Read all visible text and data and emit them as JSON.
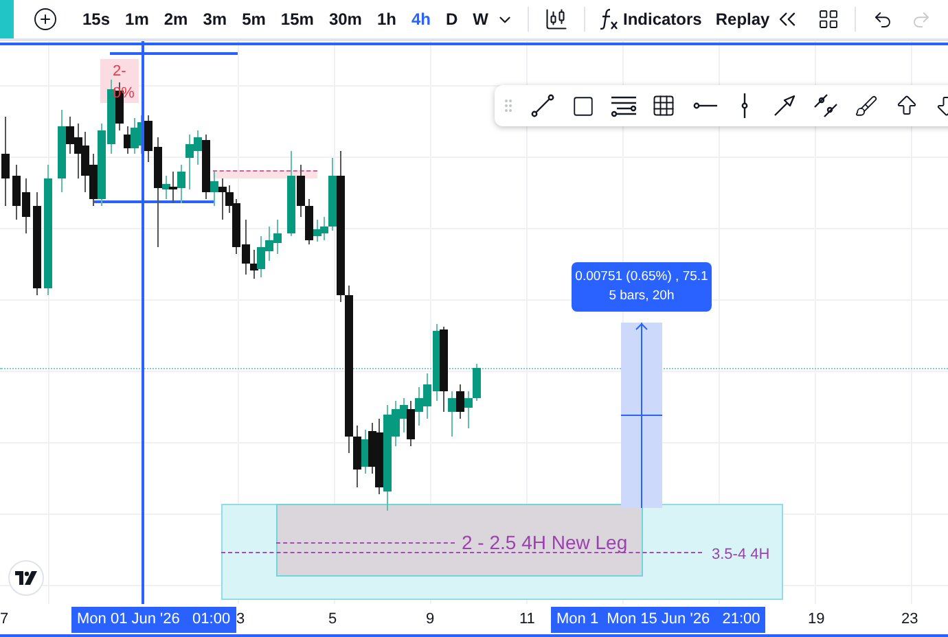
{
  "toolbar": {
    "intervals": [
      {
        "label": "15s",
        "selected": false
      },
      {
        "label": "1m",
        "selected": false
      },
      {
        "label": "2m",
        "selected": false
      },
      {
        "label": "3m",
        "selected": false
      },
      {
        "label": "5m",
        "selected": false
      },
      {
        "label": "15m",
        "selected": false
      },
      {
        "label": "30m",
        "selected": false
      },
      {
        "label": "1h",
        "selected": false
      },
      {
        "label": "4h",
        "selected": true
      },
      {
        "label": "D",
        "selected": false
      },
      {
        "label": "W",
        "selected": false
      }
    ],
    "indicators": "Indicators",
    "replay": "Replay",
    "undo": {
      "disabled": false
    },
    "redo": {
      "disabled": true
    }
  },
  "chart": {
    "marker_labels": [
      "2-",
      "0%"
    ],
    "measure": {
      "line_1": "0.00751 (0.65%) , 75.1",
      "line_2": "5 bars, 20h"
    },
    "zone_labels": [
      "2 - 2.5 4H New Leg",
      "3.5-4 4H"
    ]
  },
  "time_axis": {
    "ticks": [
      {
        "label": "7",
        "highlighted": false
      },
      {
        "label": "Mon 01 Jun '26   01:00",
        "highlighted": true
      },
      {
        "label": "3",
        "highlighted": false
      },
      {
        "label": "5",
        "highlighted": false
      },
      {
        "label": "9",
        "highlighted": false
      },
      {
        "label": "11",
        "highlighted": false
      },
      {
        "label": "Mon 1  Mon 15 Jun '26   21:00",
        "highlighted": true
      },
      {
        "label": "19",
        "highlighted": false
      },
      {
        "label": "23",
        "highlighted": false
      }
    ]
  }
}
